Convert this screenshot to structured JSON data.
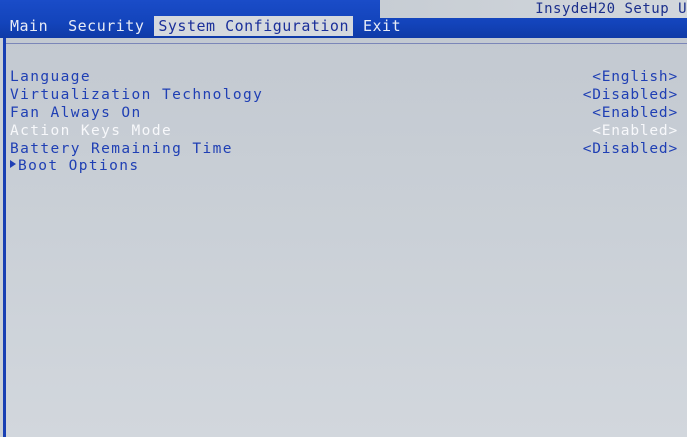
{
  "header": {
    "vendor_title": "InsydeH20 Setup U",
    "tabs": [
      {
        "label": "Main"
      },
      {
        "label": "Security"
      },
      {
        "label": "System Configuration",
        "active": true
      },
      {
        "label": "Exit"
      }
    ]
  },
  "menu": {
    "items": [
      {
        "label": "Language",
        "value": "<English>"
      },
      {
        "label": "Virtualization Technology",
        "value": "<Disabled>"
      },
      {
        "label": "Fan Always On",
        "value": "<Enabled>"
      },
      {
        "label": "Action Keys Mode",
        "value": "<Enabled>",
        "selected": true
      },
      {
        "label": "Battery Remaining Time",
        "value": "<Disabled>"
      },
      {
        "label": "Boot Options",
        "submenu": true
      }
    ]
  },
  "colors": {
    "header_blue": "#1344bb",
    "panel_gray": "#c9cfd6",
    "text_blue": "#1f3fb4",
    "selected_text": "#f7f8fb"
  }
}
